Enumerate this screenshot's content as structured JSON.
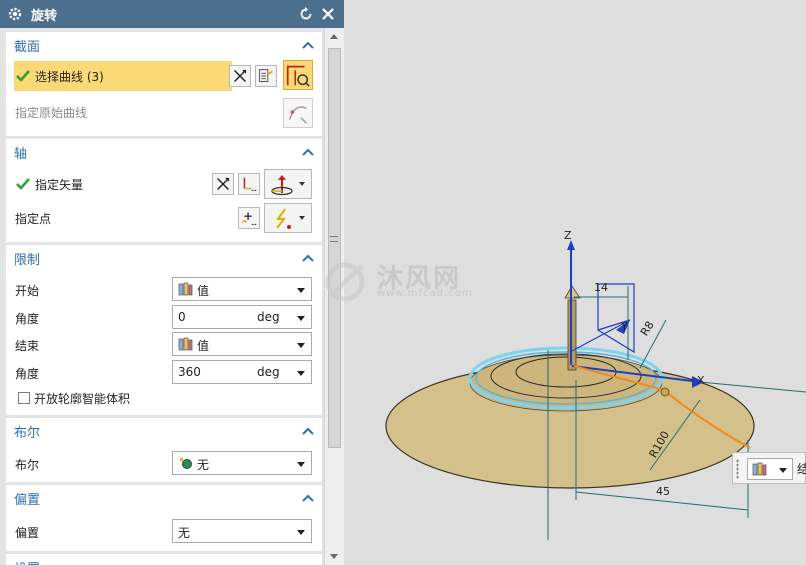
{
  "dialog": {
    "title": "旋转"
  },
  "section": {
    "header": "截面",
    "select_curve_label": "选择曲线 (3)",
    "specify_origin_curve_label": "指定原始曲线"
  },
  "axis": {
    "header": "轴",
    "specify_vector_label": "指定矢量",
    "specify_point_label": "指定点"
  },
  "limits": {
    "header": "限制",
    "start_label": "开始",
    "start_value": "值",
    "start_angle_label": "角度",
    "start_angle_value": "0",
    "start_angle_unit": "deg",
    "end_label": "结束",
    "end_value": "值",
    "end_angle_label": "角度",
    "end_angle_value": "360",
    "end_angle_unit": "deg",
    "open_profile_label": "开放轮廓智能体积",
    "open_profile_checked": false
  },
  "boolean": {
    "header": "布尔",
    "label": "布尔",
    "value": "无"
  },
  "offset": {
    "header": "偏置",
    "label": "偏置",
    "value": "无"
  },
  "settings": {
    "header": "设置"
  },
  "viewport": {
    "watermark_brand": "沐风网",
    "watermark_site": "www.mfcad.com",
    "axis_z": "Z",
    "axis_y": "Y",
    "axis_x": "X",
    "dim_14": "14",
    "dim_r8": "R8",
    "dim_r100": "R100",
    "dim_45": "45",
    "mini_toolbar_partial_text": "结"
  },
  "colors": {
    "titlebar": "#4b6f8c",
    "section_header": "#2e6fb0",
    "selected_row": "#fbd975",
    "check_green": "#2fa12f",
    "model_fill": "#d4c08a",
    "ring_cyan": "#7fd3f0"
  }
}
